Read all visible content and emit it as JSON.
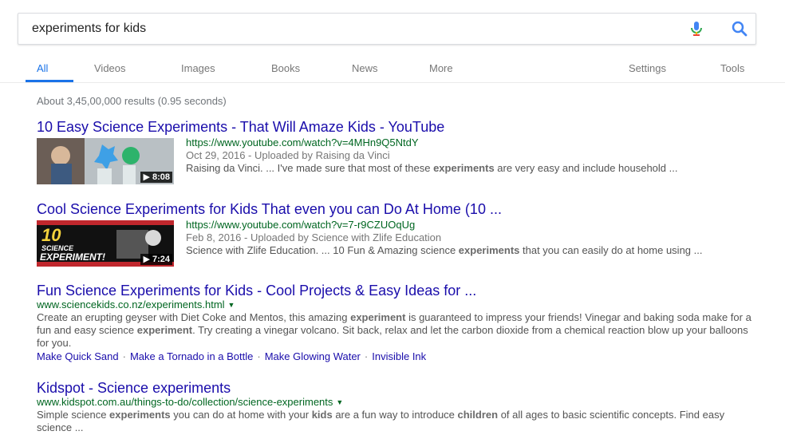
{
  "search": {
    "query": "experiments for kids",
    "mic_icon": "microphone-icon",
    "search_icon": "search-icon"
  },
  "tabs": {
    "items": [
      "All",
      "Videos",
      "Images",
      "Books",
      "News",
      "More"
    ],
    "settings": "Settings",
    "tools": "Tools",
    "active": "All",
    "active_color": "#1a73e8"
  },
  "stats": "About 3,45,00,000 results (0.95 seconds)",
  "results": [
    {
      "title": "10 Easy Science Experiments - That Will Amaze Kids - YouTube",
      "url": "https://www.youtube.com/watch?v=4MHn9Q5NtdY",
      "meta": "Oct 29, 2016 - Uploaded by Raising da Vinci",
      "snippet_parts": [
        "Raising da Vinci. ... I've made sure that most of these ",
        "experiments",
        " are very easy and include household ..."
      ],
      "duration": "8:08"
    },
    {
      "title": "Cool Science Experiments for Kids That even you can Do At Home (10 ...",
      "url": "https://www.youtube.com/watch?v=7-r9CZUOqUg",
      "meta": "Feb 8, 2016 - Uploaded by Science with Zlife Education",
      "snippet_parts": [
        "Science with Zlife Education. ... 10 Fun & Amazing science ",
        "experiments",
        " that you can easily do at home using ..."
      ],
      "duration": "7:24",
      "thumb_text": [
        "10",
        "SCIENCE",
        "EXPERIMENT!"
      ]
    },
    {
      "title": "Fun Science Experiments for Kids - Cool Projects & Easy Ideas for ...",
      "url": "www.sciencekids.co.nz/experiments.html",
      "snippet_parts": [
        "Create an erupting geyser with Diet Coke and Mentos, this amazing ",
        "experiment",
        " is guaranteed to impress your friends! Vinegar and baking soda make for a fun and easy science ",
        "experiment",
        ". Try creating a vinegar volcano. Sit back, relax and let the carbon dioxide from a chemical reaction blow up your balloons for you."
      ],
      "sitelinks": [
        "Make Quick Sand",
        "Make a Tornado in a Bottle",
        "Make Glowing Water",
        "Invisible Ink"
      ],
      "sitelink_separator": "·"
    },
    {
      "title": "Kidspot - Science experiments",
      "url": "www.kidspot.com.au/things-to-do/collection/science-experiments",
      "snippet_parts": [
        "Simple science ",
        "experiments",
        " you can do at home with your ",
        "kids",
        " are a fun way to introduce ",
        "children",
        " of all ages to basic scientific concepts. Find easy science ..."
      ]
    }
  ],
  "colors": {
    "title_link": "#1a0dab",
    "url_green": "#006621",
    "snippet": "#545454",
    "meta": "#777777"
  }
}
